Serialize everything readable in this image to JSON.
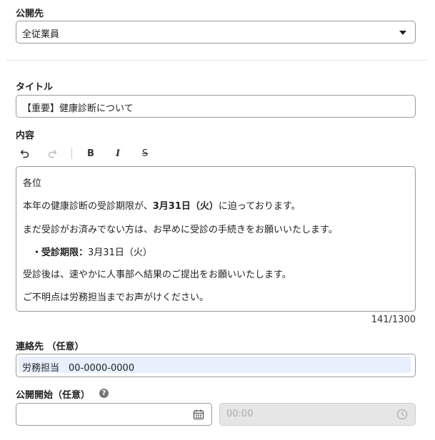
{
  "visibility": {
    "label": "公開先",
    "value": "全従業員"
  },
  "title_field": {
    "label": "タイトル",
    "value": "【重要】健康診断について"
  },
  "content": {
    "label": "内容",
    "toolbar": {
      "undo": "undo-icon",
      "redo": "redo-icon",
      "bold": "B",
      "italic": "I",
      "strike": "S"
    },
    "lines": {
      "greeting": "各位",
      "line1_pre": "本年の健康診断の受診期限が、",
      "line1_bold": "3月31日（火）",
      "line1_post": "に迫っております。",
      "line2": "まだ受診がお済みでない方は、お早めに受診の手続きをお願いいたします。",
      "bullet": "・",
      "bullet_bold": "受診期限：",
      "bullet_value": "3月31日（火）",
      "line3": "受診後は、速やかに人事部へ結果のご提出をお願いいたします。",
      "line4": "ご不明点は労務担当までお声がけください。"
    },
    "counter": "141/1300"
  },
  "contact": {
    "label": "連絡先 （任意）",
    "value": "労務担当　00-0000-0000"
  },
  "publish_start": {
    "label": "公開開始（任意）",
    "help": "?",
    "time_placeholder": "00:00"
  }
}
